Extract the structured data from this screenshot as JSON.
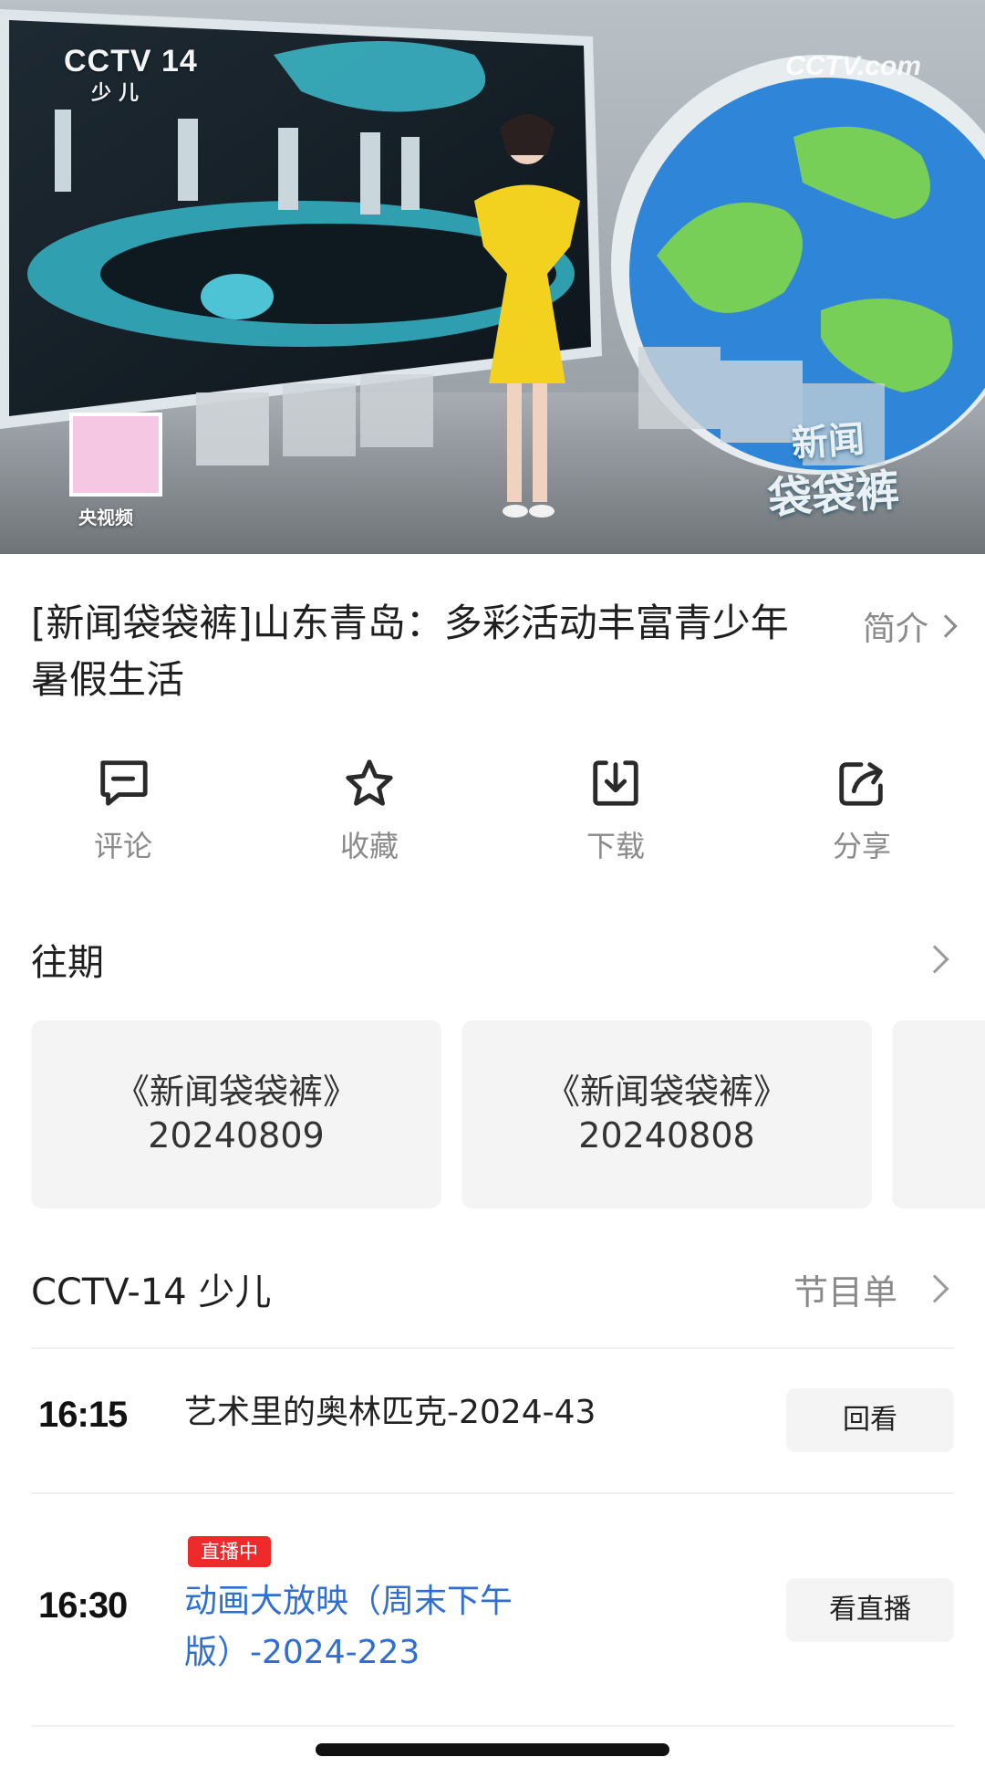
{
  "player": {
    "channel_logo": "CCTV 14",
    "channel_sub": "少儿",
    "watermark": "CCTV.com",
    "badge_text": "央视频",
    "show_logo_line1": "新闻",
    "show_logo_line2": "袋袋裤"
  },
  "video": {
    "title": "[新闻袋袋裤]山东青岛：多彩活动丰富青少年暑假生活",
    "intro_label": "简介"
  },
  "actions": [
    {
      "label": "评论",
      "icon": "comment-icon"
    },
    {
      "label": "收藏",
      "icon": "star-icon"
    },
    {
      "label": "下载",
      "icon": "download-icon"
    },
    {
      "label": "分享",
      "icon": "share-icon"
    }
  ],
  "past": {
    "title": "往期",
    "episodes": [
      {
        "name": "《新闻袋袋裤》",
        "date": "20240809"
      },
      {
        "name": "《新闻袋袋裤》",
        "date": "20240808"
      }
    ]
  },
  "schedule": {
    "channel": "CCTV-14 少儿",
    "guide_label": "节目单",
    "items": [
      {
        "time": "16:15",
        "name": "艺术里的奥林匹克-2024-43",
        "button": "回看",
        "live": false
      },
      {
        "time": "16:30",
        "name": "动画大放映（周末下午版）-2024-223",
        "button": "看直播",
        "live": true,
        "badge": "直播中"
      }
    ]
  },
  "colors": {
    "live_badge": "#ef2a2a",
    "live_text": "#2f6ed3",
    "muted": "#8a8a8a",
    "card_bg": "#f4f4f4"
  }
}
